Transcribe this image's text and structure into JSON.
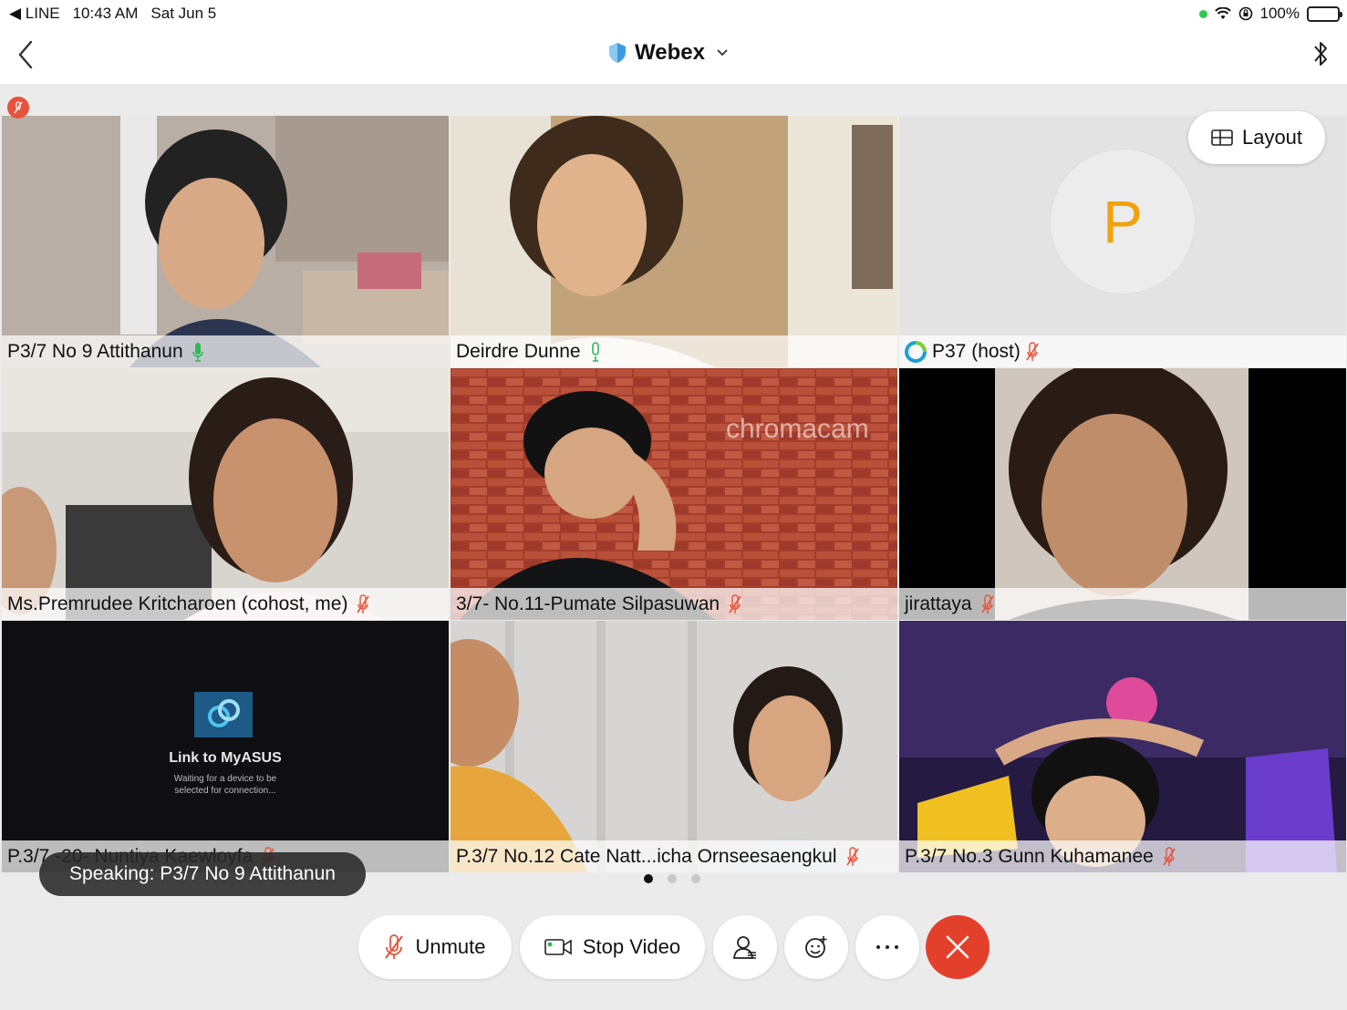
{
  "status_bar": {
    "back_app": "◀ LINE",
    "time": "10:43 AM",
    "date": "Sat Jun 5",
    "battery": "100%"
  },
  "header": {
    "title": "Webex"
  },
  "layout_button": {
    "label": "Layout"
  },
  "host_avatar_letter": "P",
  "tiles": [
    {
      "name": "P3/7 No 9 Attithanun",
      "audio": "speaking"
    },
    {
      "name": "Deirdre Dunne",
      "audio": "on"
    },
    {
      "name": "P37 (host)",
      "audio": "muted"
    },
    {
      "name": "Ms.Premrudee Kritcharoen (cohost, me)",
      "audio": "muted"
    },
    {
      "name": "3/7- No.11-Pumate Silpasuwan",
      "audio": "muted"
    },
    {
      "name": "jirattaya",
      "audio": "muted"
    },
    {
      "name": "P.3/7 -20- Nuntiya Kaewloyfa",
      "audio": "muted"
    },
    {
      "name": "P.3/7 No.12 Cate Natt...icha Ornseesaengkul",
      "audio": "muted"
    },
    {
      "name": "P.3/7 No.3 Gunn Kuhamanee",
      "audio": "muted"
    }
  ],
  "screen_share": {
    "title": "Link to MyASUS",
    "subtitle_line1": "Waiting for a device to be",
    "subtitle_line2": "selected for connection..."
  },
  "virtual_bg_text": "chromacam",
  "toast": {
    "text": "Speaking: P3/7 No 9 Attithanun"
  },
  "pager": {
    "pages": 3,
    "current": 1
  },
  "controls": {
    "unmute_label": "Unmute",
    "stop_video_label": "Stop Video"
  },
  "colors": {
    "accent": "#1a7fbf",
    "end_call": "#e3402c",
    "mic_active": "#2dbb55",
    "muted": "#e5533c",
    "avatar_letter": "#f0a30a"
  }
}
